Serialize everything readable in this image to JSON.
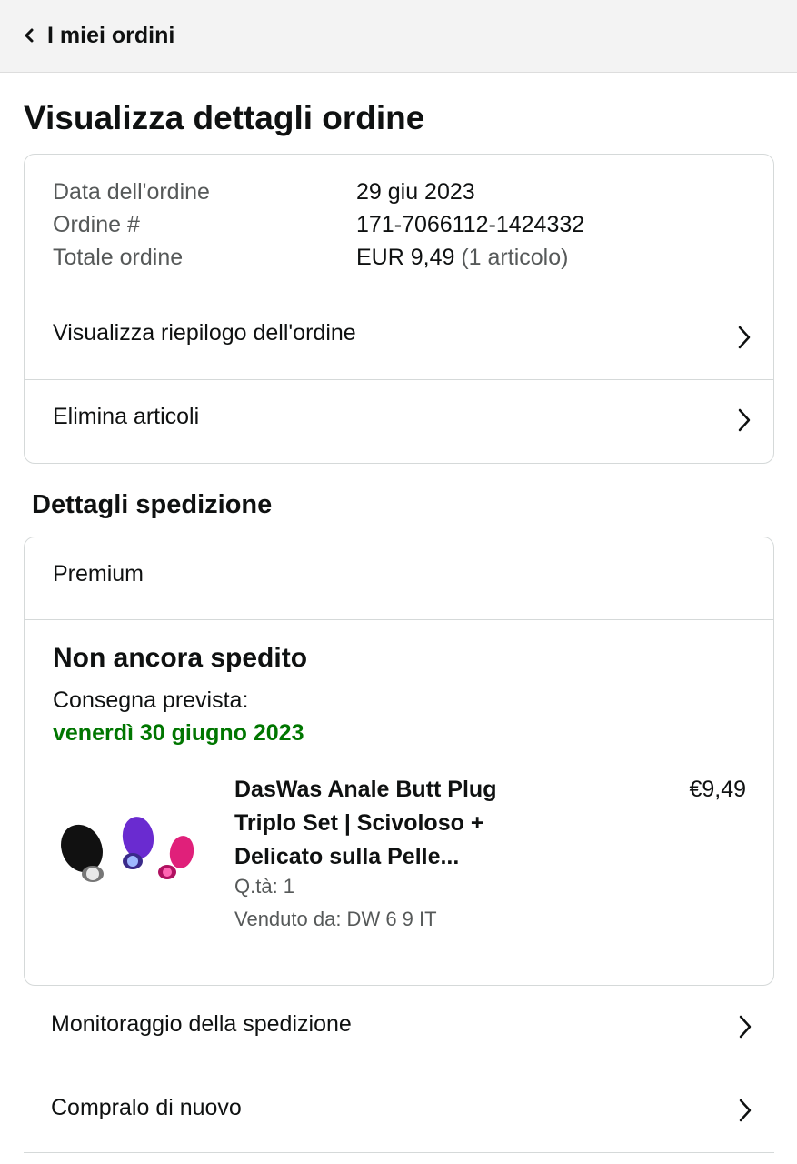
{
  "header": {
    "back_label": "I miei ordini"
  },
  "page_title": "Visualizza dettagli ordine",
  "order_info": {
    "date_label": "Data dell'ordine",
    "date_value": "29 giu 2023",
    "number_label": "Ordine #",
    "number_value": "171-7066112-1424332",
    "total_label": "Totale ordine",
    "total_value": "EUR 9,49",
    "total_items": "(1 articolo)"
  },
  "order_actions": [
    {
      "label": "Visualizza riepilogo dell'ordine"
    },
    {
      "label": "Elimina articoli"
    }
  ],
  "shipment": {
    "section_title": "Dettagli spedizione",
    "shipping_type": "Premium",
    "status": "Non ancora spedito",
    "expected_label": "Consegna prevista:",
    "expected_date": "venerdì 30 giugno 2023",
    "product": {
      "title": "DasWas Anale Butt Plug Triplo Set | Scivoloso + Delicato sulla Pelle...",
      "price": "€9,49",
      "quantity": "Q.tà: 1",
      "seller": "Venduto da: DW 6 9 IT"
    }
  },
  "shipment_actions": [
    {
      "label": "Monitoraggio della spedizione"
    },
    {
      "label": "Compralo di nuovo"
    }
  ],
  "colors": {
    "delivery_date": "#007600",
    "header_bg": "#f3f3f3",
    "border": "#d5d9d9",
    "muted_text": "#565959"
  }
}
